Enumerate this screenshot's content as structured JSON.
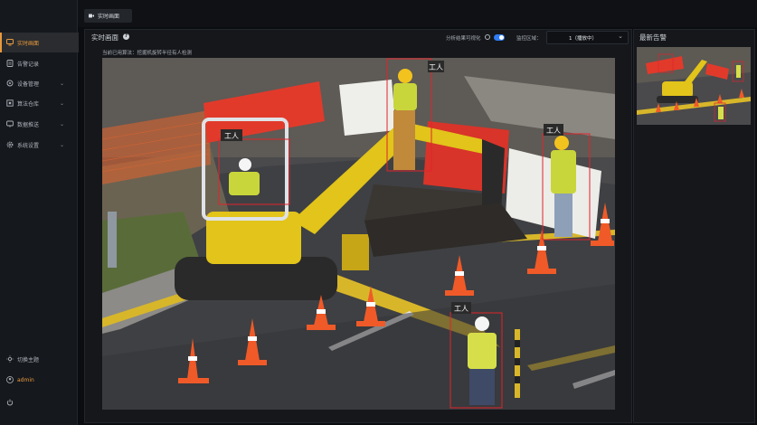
{
  "sidebar": {
    "items": [
      {
        "label": "实时画面",
        "icon": "monitor-icon",
        "active": true
      },
      {
        "label": "告警记录",
        "icon": "alarm-log-icon"
      },
      {
        "label": "设备管理",
        "icon": "device-icon",
        "chevron": "⌄"
      },
      {
        "label": "算法仓库",
        "icon": "algorithm-icon",
        "chevron": "⌄"
      },
      {
        "label": "数据推送",
        "icon": "push-icon",
        "chevron": "⌄"
      },
      {
        "label": "系统设置",
        "icon": "settings-icon",
        "chevron": "⌄"
      }
    ],
    "bottom": {
      "theme_label": "切换主题",
      "user_label": "admin"
    }
  },
  "tab": {
    "label": "实时画面"
  },
  "live": {
    "title": "实时画面",
    "help_glyph": "?",
    "current_algorithm_label": "当前已用算法：",
    "current_algorithm_value": "挖掘机旋转半径有人检测",
    "visualize_label": "分析结果可视化",
    "monitor_label": "监控区域：",
    "monitor_value": "1（播放中）",
    "detections": [
      {
        "label": "工人"
      },
      {
        "label": "工人"
      },
      {
        "label": "工人"
      },
      {
        "label": "工人"
      }
    ]
  },
  "alerts": {
    "title": "最新告警"
  },
  "colors": {
    "accent": "#e89a3c",
    "toggle": "#2e7cf6",
    "box": "#e0242c"
  }
}
